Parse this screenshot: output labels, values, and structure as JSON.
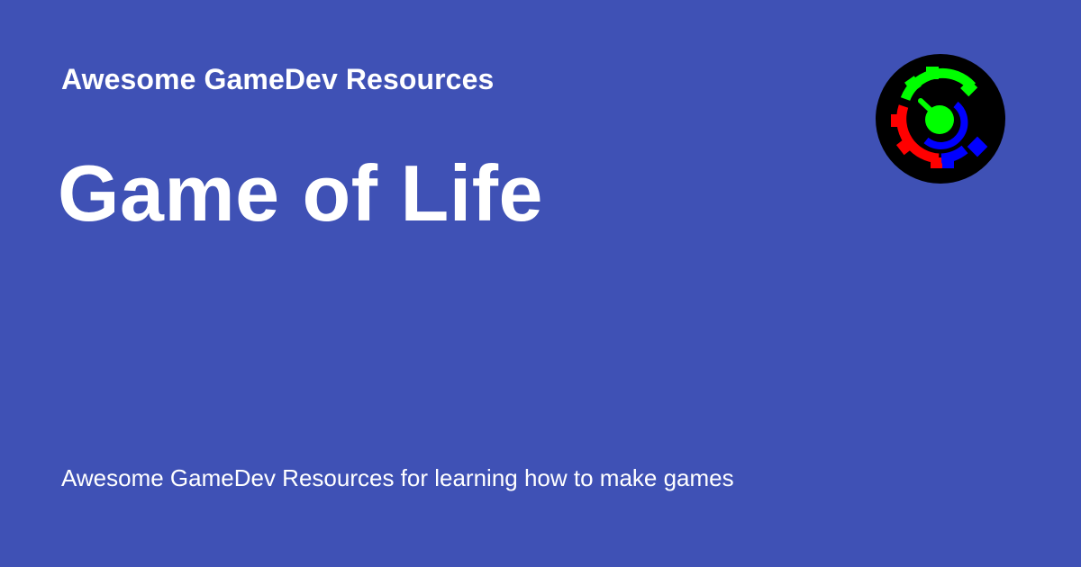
{
  "site": {
    "name": "Awesome GameDev Resources"
  },
  "page": {
    "title": "Game of Life",
    "description": "Awesome GameDev Resources for learning how to make games"
  },
  "logo": {
    "icon": "gear-logo-icon"
  },
  "colors": {
    "background": "#3f51b5",
    "text": "#ffffff",
    "logo_background": "#000000",
    "logo_green": "#00ff00",
    "logo_red": "#ff0000",
    "logo_blue": "#0000ff"
  }
}
